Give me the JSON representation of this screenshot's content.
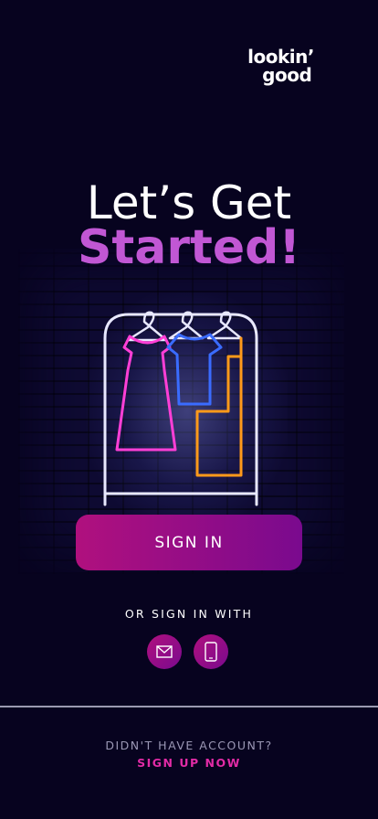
{
  "brand": {
    "line1": "lookin’",
    "line2": "good"
  },
  "hero": {
    "line1": "Let’s Get",
    "line2": "Started!"
  },
  "signin_button": "SIGN IN",
  "alt_signin_label": "OR SIGN IN WITH",
  "alt_methods": [
    {
      "icon": "mail-icon"
    },
    {
      "icon": "smartphone-icon"
    }
  ],
  "footer": {
    "prompt": "DIDN'T HAVE ACCOUNT?",
    "signup_link": "SIGN UP NOW"
  },
  "colors": {
    "background": "#07031f",
    "accent_pink": "#b0107e",
    "accent_purple": "#7a0a8e",
    "headline_purple": "#c157d4",
    "link_pink": "#e22ba6"
  }
}
